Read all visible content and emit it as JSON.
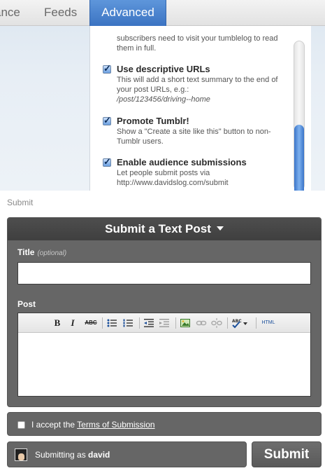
{
  "tabs": [
    {
      "label": "ance"
    },
    {
      "label": "Feeds"
    },
    {
      "label": "Advanced"
    }
  ],
  "settings": {
    "lead_text": "subscribers need to visit your tumblelog to read them in full.",
    "options": [
      {
        "title": "Use descriptive URLs",
        "desc": "This will add a short text summary to the end of your post URLs, e.g.:",
        "example": "/post/123456/driving--home",
        "checked": true
      },
      {
        "title": "Promote Tumblr!",
        "desc": "Show a \"Create a site like this\" button to non-Tumblr users.",
        "checked": true
      },
      {
        "title": "Enable audience submissions",
        "desc": "Let people submit posts via http://www.davidslog.com/submit",
        "checked": true
      }
    ]
  },
  "form": {
    "section_label": "Submit",
    "header": "Submit a Text Post",
    "title_label": "Title",
    "title_optional": "(optional)",
    "title_value": "",
    "post_label": "Post",
    "toolbar": {
      "bold": "B",
      "italic": "I",
      "strike": "ABC",
      "html": "HTML"
    },
    "accept_prefix": "I accept the",
    "accept_link": "Terms of Submission",
    "submitting_as_prefix": "Submitting as",
    "username": "david",
    "submit_label": "Submit"
  },
  "colors": {
    "active_tab": "#4a84d2",
    "form_bg": "#666666",
    "form_header": "#444444"
  }
}
